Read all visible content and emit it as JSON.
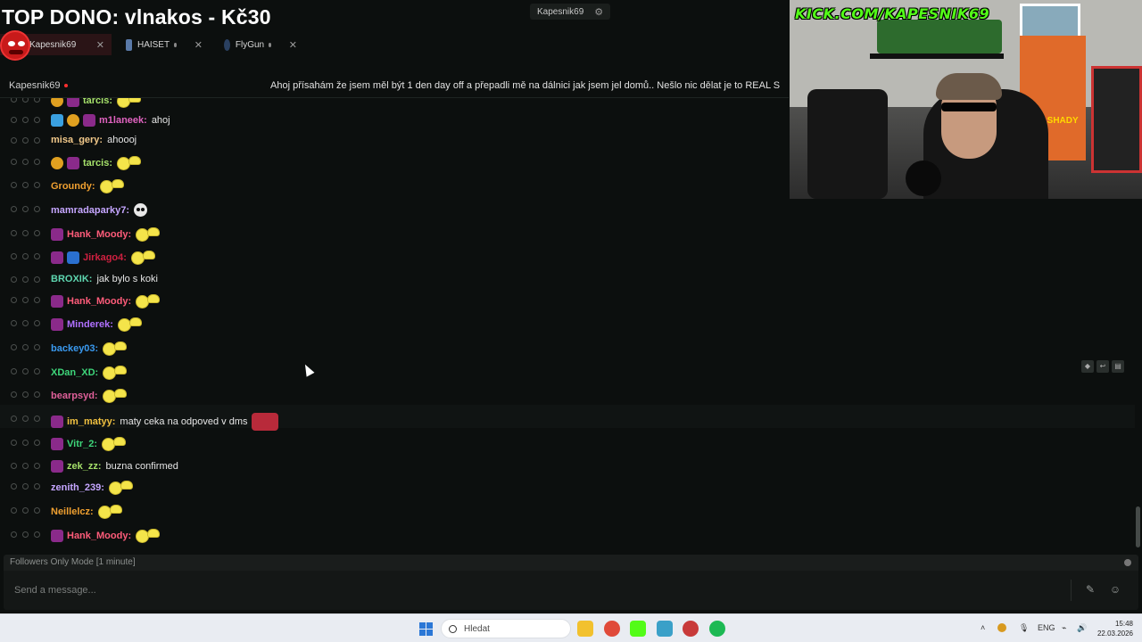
{
  "banner": {
    "text": "TOP DONO: vlnakos - Kč30"
  },
  "header": {
    "channel_chip": "Kapesnik69",
    "tabs": [
      {
        "label": "Kapesnik69",
        "active": true
      },
      {
        "label": "HAISET",
        "active": false
      },
      {
        "label": "FlyGun",
        "active": false
      }
    ],
    "streamer": "Kapesnik69",
    "stream_title": "Ahoj přísahám že jsem měl být 1 den day off a přepadli mě na dálnici jak jsem jel domů.. Nešlo nic dělat je to REAL S"
  },
  "webcam": {
    "overlay_text": "KICK.COM/KAPESNIK69",
    "poster_text": "SLIM SHADY"
  },
  "chat": {
    "messages": [
      {
        "user": "tarcis:",
        "color": "#a5e06a",
        "badges": [
          "gold",
          "sub"
        ],
        "text": "",
        "emote": "wave"
      },
      {
        "user": "m1laneek:",
        "color": "#e063c0",
        "badges": [
          "blue",
          "gold",
          "sub"
        ],
        "text": "ahoj",
        "emote": ""
      },
      {
        "user": "misa_gery:",
        "color": "#f2c98a",
        "badges": [],
        "text": "ahoooj",
        "emote": ""
      },
      {
        "user": "tarcis:",
        "color": "#a5e06a",
        "badges": [
          "gold",
          "sub"
        ],
        "text": "",
        "emote": "wave"
      },
      {
        "user": "Groundy:",
        "color": "#f0a030",
        "badges": [],
        "text": "",
        "emote": "wave"
      },
      {
        "user": "mamradaparky7:",
        "color": "#c5a6ff",
        "badges": [],
        "text": "",
        "emote": "skull"
      },
      {
        "user": "Hank_Moody:",
        "color": "#ff5c7a",
        "badges": [
          "sub"
        ],
        "text": "",
        "emote": "wave"
      },
      {
        "user": "Jirkago4:",
        "color": "#d02040",
        "badges": [
          "sub",
          "vip"
        ],
        "text": "",
        "emote": "wave"
      },
      {
        "user": "BROXIK:",
        "color": "#5ed6b0",
        "badges": [],
        "text": "jak bylo s koki",
        "emote": ""
      },
      {
        "user": "Hank_Moody:",
        "color": "#ff5c7a",
        "badges": [
          "sub"
        ],
        "text": "",
        "emote": "wave"
      },
      {
        "user": "Minderek:",
        "color": "#b070ff",
        "badges": [
          "sub"
        ],
        "text": "",
        "emote": "wave"
      },
      {
        "user": "backey03:",
        "color": "#3a9af0",
        "badges": [],
        "text": "",
        "emote": "wave"
      },
      {
        "user": "XDan_XD:",
        "color": "#3ed67a",
        "badges": [],
        "text": "",
        "emote": "wave"
      },
      {
        "user": "bearpsyd:",
        "color": "#e0609a",
        "badges": [],
        "text": "",
        "emote": "wave"
      },
      {
        "user": "im_matyy:",
        "color": "#f0c040",
        "badges": [
          "sub"
        ],
        "text": "maty ceka na odpoved v dms",
        "emote": "car"
      },
      {
        "user": "Vitr_2:",
        "color": "#3ed67a",
        "badges": [
          "sub"
        ],
        "text": "",
        "emote": "wave"
      },
      {
        "user": "zek_zz:",
        "color": "#a5e06a",
        "badges": [
          "sub"
        ],
        "text": "buzna confirmed",
        "emote": ""
      },
      {
        "user": "zenith_239:",
        "color": "#c5a6ff",
        "badges": [],
        "text": "",
        "emote": "wave"
      },
      {
        "user": "Neillelcz:",
        "color": "#f0a030",
        "badges": [],
        "text": "",
        "emote": "wave"
      },
      {
        "user": "Hank_Moody:",
        "color": "#ff5c7a",
        "badges": [
          "sub"
        ],
        "text": "",
        "emote": "wave"
      }
    ],
    "mode_label": "Followers Only Mode [1 minute]",
    "input_placeholder": "Send a message..."
  },
  "taskbar": {
    "search_label": "Hledat",
    "lang": "ENG",
    "time": "15:48",
    "date": "22.03.2026"
  }
}
